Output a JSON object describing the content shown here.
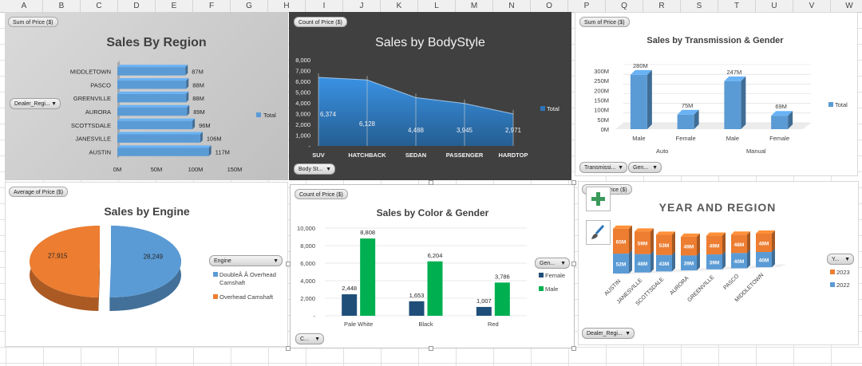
{
  "columns": [
    "A",
    "B",
    "C",
    "D",
    "E",
    "F",
    "G",
    "H",
    "I",
    "J",
    "K",
    "L",
    "M",
    "N",
    "O",
    "P",
    "Q",
    "R",
    "S",
    "T",
    "U",
    "V",
    "W"
  ],
  "region": {
    "title": "Sales By Region",
    "field_button": "Sum of Price ($)",
    "filter_button": "Dealer_Regi...",
    "legend": [
      "Total"
    ],
    "colors": {
      "bar": "#5b9bd5",
      "background": "#d0d0d0"
    },
    "chart_data": {
      "type": "bar",
      "orientation": "horizontal",
      "title": "Sales By Region",
      "categories": [
        "MIDDLETOWN",
        "PASCO",
        "GREENVILLE",
        "AURORA",
        "SCOTTSDALE",
        "JANESVILLE",
        "AUSTIN"
      ],
      "values": [
        87,
        88,
        88,
        89,
        96,
        106,
        117
      ],
      "data_labels": [
        "87M",
        "88M",
        "88M",
        "89M",
        "96M",
        "106M",
        "117M"
      ],
      "series": [
        {
          "name": "Total",
          "values": [
            87,
            88,
            88,
            89,
            96,
            106,
            117
          ]
        }
      ],
      "x_ticks": [
        "0M",
        "50M",
        "100M",
        "150M"
      ],
      "xlim": [
        0,
        150
      ],
      "legend": "right",
      "grid": false
    }
  },
  "bodystyle": {
    "title": "Sales by BodyStyle",
    "field_button": "Count of Price ($)",
    "filter_button": "Body St...",
    "legend": [
      "Total"
    ],
    "colors": {
      "area": "#2e75b6",
      "background": "#404040"
    },
    "chart_data": {
      "type": "area",
      "title": "Sales by BodyStyle",
      "categories": [
        "SUV",
        "HATCHBACK",
        "SEDAN",
        "PASSENGER",
        "HARDTOP"
      ],
      "values": [
        6374,
        6128,
        4488,
        3945,
        2971
      ],
      "series": [
        {
          "name": "Total",
          "values": [
            6374,
            6128,
            4488,
            3945,
            2971
          ]
        }
      ],
      "data_labels": [
        "6,374",
        "6,128",
        "4,488",
        "3,945",
        "2,971"
      ],
      "y_ticks": [
        "-",
        "1,000",
        "2,000",
        "3,000",
        "4,000",
        "5,000",
        "6,000",
        "7,000",
        "8,000"
      ],
      "ylim": [
        0,
        8000
      ],
      "legend": "right",
      "grid": false
    }
  },
  "transmission": {
    "title": "Sales by Transmission & Gender",
    "field_button": "Sum of Price ($)",
    "filter_buttons": [
      "Transmissi...",
      "Gen..."
    ],
    "legend": [
      "Total"
    ],
    "colors": {
      "bar": "#5b9bd5"
    },
    "chart_data": {
      "type": "bar",
      "title": "Sales by Transmission & Gender",
      "categories": [
        "Male",
        "Female",
        "Male",
        "Female"
      ],
      "groups": [
        "Auto",
        "Manual"
      ],
      "values": [
        280,
        75,
        247,
        69
      ],
      "series": [
        {
          "name": "Total",
          "values": [
            280,
            75,
            247,
            69
          ]
        }
      ],
      "data_labels": [
        "280M",
        "75M",
        "247M",
        "69M"
      ],
      "y_ticks": [
        "0M",
        "50M",
        "100M",
        "150M",
        "200M",
        "250M",
        "300M"
      ],
      "ylim": [
        0,
        300
      ],
      "legend": "right",
      "grid": true
    }
  },
  "engine": {
    "title": "Sales by Engine",
    "field_button": "Average of Price ($)",
    "filter_button": "Engine",
    "legend": [
      "DoubleÂ Â Overhead Camshaft",
      "Overhead Camshaft"
    ],
    "colors": {
      "double": "#5b9bd5",
      "overhead": "#ed7d31"
    },
    "chart_data": {
      "type": "pie",
      "title": "Sales by Engine",
      "categories": [
        "DoubleÂ Â Overhead Camshaft",
        "Overhead Camshaft"
      ],
      "values": [
        28249,
        27915
      ],
      "data_labels": [
        "28,249",
        "27,915"
      ],
      "legend": "right"
    }
  },
  "color": {
    "title": "Sales by Color & Gender",
    "field_button": "Count of Price ($)",
    "filter_buttons": [
      "C...",
      "Gen..."
    ],
    "legend": [
      "Female",
      "Male"
    ],
    "colors": {
      "female": "#1f4e79",
      "male": "#00b050"
    },
    "chart_data": {
      "type": "bar",
      "title": "Sales by Color & Gender",
      "categories": [
        "Pale White",
        "Black",
        "Red"
      ],
      "series": [
        {
          "name": "Female",
          "values": [
            2448,
            1653,
            1007
          ],
          "data_labels": [
            "2,448",
            "1,653",
            "1,007"
          ]
        },
        {
          "name": "Male",
          "values": [
            8808,
            6204,
            3786
          ],
          "data_labels": [
            "8,808",
            "6,204",
            "3,786"
          ]
        }
      ],
      "y_ticks": [
        "-",
        "2,000",
        "4,000",
        "6,000",
        "8,000",
        "10,000"
      ],
      "ylim": [
        0,
        10000
      ],
      "legend": "right",
      "grid": true
    }
  },
  "year": {
    "title": "YEAR AND REGION",
    "field_button": "Sum of Price ($)",
    "filter_buttons": [
      "Y...",
      "Dealer_Regi..."
    ],
    "legend": [
      "2023",
      "2022"
    ],
    "colors": {
      "y2022": "#5b9bd5",
      "y2023": "#ed7d31"
    },
    "tools": [
      "plus-icon",
      "brush-icon"
    ],
    "chart_data": {
      "type": "bar",
      "stacked": true,
      "title": "YEAR AND REGION",
      "categories": [
        "AUSTIN",
        "JANESVILLE",
        "SCOTTSDALE",
        "AURORA",
        "GREENVILLE",
        "PASCO",
        "MIDDLETOWN"
      ],
      "series": [
        {
          "name": "2022",
          "values": [
            52,
            48,
            43,
            39,
            39,
            40,
            40
          ],
          "data_labels": [
            "52M",
            "48M",
            "43M",
            "39M",
            "39M",
            "40M",
            "40M"
          ]
        },
        {
          "name": "2023",
          "values": [
            65,
            59,
            53,
            49,
            49,
            48,
            48
          ],
          "data_labels": [
            "65M",
            "59M",
            "53M",
            "49M",
            "49M",
            "48M",
            "48M"
          ]
        }
      ],
      "legend": "right"
    }
  }
}
